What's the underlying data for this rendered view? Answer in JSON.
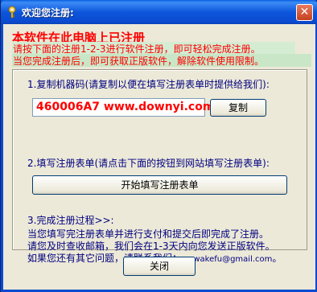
{
  "window": {
    "title": "欢迎您注册:",
    "close_glyph": "✕"
  },
  "header": {
    "headline": "本软件在此电脑上已注册",
    "line1": "请按下面的注册1-2-3进行软件注册，即可轻松完成注册。",
    "line2": "当您完成注册后，即可获取正版软件，解除软件使用限制。"
  },
  "step1": {
    "label": "1.复制机器码(请复制以便在填写注册表单时提供给我们):",
    "machine_code": "460006A7 www.downyi.com",
    "copy_label": "复制"
  },
  "step2": {
    "label": "2.填写注册表单(请点击下面的按钮到网站填写注册表单):",
    "button_label": "开始填写注册表单"
  },
  "step3": {
    "label": "3.完成注册过程>>:",
    "info1": "当您填写完注册表单并进行支付和提交后即完成了注册。",
    "info2": "请您及时查收邮箱，我们会在1-3天内向您发送正版软件。",
    "info3_text": "如果您还有其它问题，请联系我们：",
    "info3_email": "wawakefu@gmail.com",
    "info3_end": "。"
  },
  "footer": {
    "close_label": "关闭"
  },
  "colors": {
    "title_bar": "#0a4ad0",
    "headline_red": "#ff0000",
    "highlight_green": "#d4ecd2",
    "text_navy": "#000080",
    "dialog_bg": "#ece9d8"
  },
  "icons": {
    "title": "key-icon"
  }
}
